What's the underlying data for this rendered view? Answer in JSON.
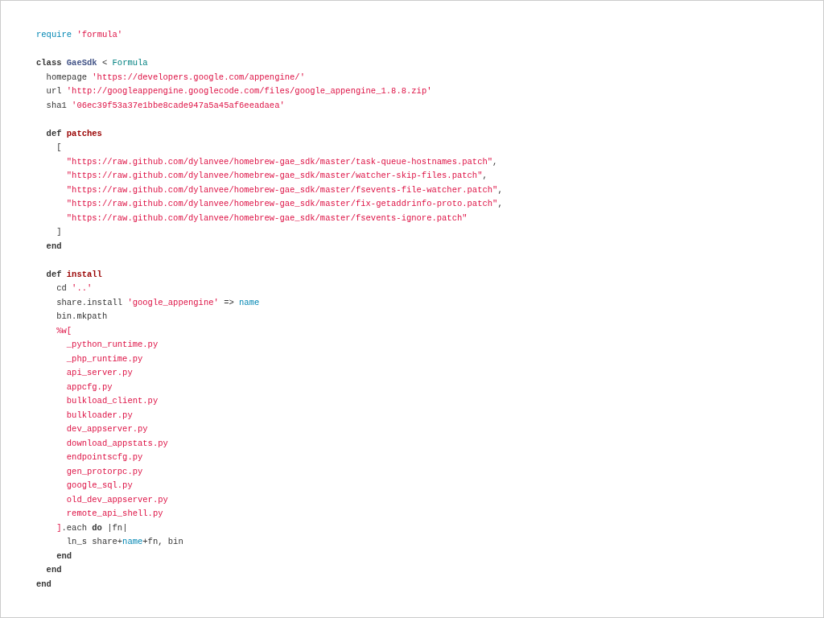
{
  "code": {
    "lines": [
      {
        "kind": "code",
        "tokens": [
          {
            "text": "require ",
            "kind": "builtin"
          },
          {
            "text": "'formula'",
            "kind": "string"
          }
        ]
      },
      {
        "kind": "blank"
      },
      {
        "kind": "code",
        "tokens": [
          {
            "text": "class ",
            "kind": "keyword"
          },
          {
            "text": "GaeSdk",
            "kind": "classname"
          },
          {
            "text": " < ",
            "kind": "plain"
          },
          {
            "text": "Formula",
            "kind": "constant"
          }
        ],
        "children": [
          {
            "kind": "code",
            "tokens": [
              {
                "text": "homepage ",
                "kind": "plain"
              },
              {
                "text": "'https://developers.google.com/appengine/'",
                "kind": "string"
              }
            ]
          },
          {
            "kind": "code",
            "tokens": [
              {
                "text": "url ",
                "kind": "plain"
              },
              {
                "text": "'http://googleappengine.googlecode.com/files/google_appengine_1.8.8.zip'",
                "kind": "string"
              }
            ]
          },
          {
            "kind": "code",
            "tokens": [
              {
                "text": "sha1 ",
                "kind": "plain"
              },
              {
                "text": "'06ec39f53a37e1bbe8cade947a5a45af6eeadaea'",
                "kind": "string"
              }
            ]
          },
          {
            "kind": "blank"
          },
          {
            "kind": "code",
            "tokens": [
              {
                "text": "def ",
                "kind": "keyword"
              },
              {
                "text": "patches",
                "kind": "function"
              }
            ],
            "children": [
              {
                "kind": "code",
                "tokens": [
                  {
                    "text": "[",
                    "kind": "plain"
                  }
                ],
                "children": [
                  {
                    "kind": "code",
                    "tokens": [
                      {
                        "text": "\"https://raw.github.com/dylanvee/homebrew-gae_sdk/master/task-queue-hostnames.patch\"",
                        "kind": "string"
                      },
                      {
                        "text": ",",
                        "kind": "plain"
                      }
                    ]
                  },
                  {
                    "kind": "code",
                    "tokens": [
                      {
                        "text": "\"https://raw.github.com/dylanvee/homebrew-gae_sdk/master/watcher-skip-files.patch\"",
                        "kind": "string"
                      },
                      {
                        "text": ",",
                        "kind": "plain"
                      }
                    ]
                  },
                  {
                    "kind": "code",
                    "tokens": [
                      {
                        "text": "\"https://raw.github.com/dylanvee/homebrew-gae_sdk/master/fsevents-file-watcher.patch\"",
                        "kind": "string"
                      },
                      {
                        "text": ",",
                        "kind": "plain"
                      }
                    ]
                  },
                  {
                    "kind": "code",
                    "tokens": [
                      {
                        "text": "\"https://raw.github.com/dylanvee/homebrew-gae_sdk/master/fix-getaddrinfo-proto.patch\"",
                        "kind": "string"
                      },
                      {
                        "text": ",",
                        "kind": "plain"
                      }
                    ]
                  },
                  {
                    "kind": "code",
                    "tokens": [
                      {
                        "text": "\"https://raw.github.com/dylanvee/homebrew-gae_sdk/master/fsevents-ignore.patch\"",
                        "kind": "string"
                      }
                    ]
                  }
                ]
              },
              {
                "kind": "code",
                "tokens": [
                  {
                    "text": "]",
                    "kind": "plain"
                  }
                ]
              }
            ]
          },
          {
            "kind": "code",
            "tokens": [
              {
                "text": "end",
                "kind": "keyword"
              }
            ]
          },
          {
            "kind": "blank"
          },
          {
            "kind": "code",
            "tokens": [
              {
                "text": "def ",
                "kind": "keyword"
              },
              {
                "text": "install",
                "kind": "function"
              }
            ],
            "children": [
              {
                "kind": "code",
                "tokens": [
                  {
                    "text": "cd ",
                    "kind": "plain"
                  },
                  {
                    "text": "'..'",
                    "kind": "string"
                  }
                ]
              },
              {
                "kind": "code",
                "tokens": [
                  {
                    "text": "share.install ",
                    "kind": "plain"
                  },
                  {
                    "text": "'google_appengine'",
                    "kind": "string"
                  },
                  {
                    "text": " => ",
                    "kind": "plain"
                  },
                  {
                    "text": "name",
                    "kind": "builtin"
                  }
                ]
              },
              {
                "kind": "code",
                "tokens": [
                  {
                    "text": "bin.mkpath",
                    "kind": "plain"
                  }
                ]
              },
              {
                "kind": "code",
                "tokens": [
                  {
                    "text": "%w[",
                    "kind": "string"
                  }
                ],
                "children": [
                  {
                    "kind": "code",
                    "tokens": [
                      {
                        "text": "_python_runtime.py",
                        "kind": "string"
                      }
                    ]
                  },
                  {
                    "kind": "code",
                    "tokens": [
                      {
                        "text": "_php_runtime.py",
                        "kind": "string"
                      }
                    ]
                  },
                  {
                    "kind": "code",
                    "tokens": [
                      {
                        "text": "api_server.py",
                        "kind": "string"
                      }
                    ]
                  },
                  {
                    "kind": "code",
                    "tokens": [
                      {
                        "text": "appcfg.py",
                        "kind": "string"
                      }
                    ]
                  },
                  {
                    "kind": "code",
                    "tokens": [
                      {
                        "text": "bulkload_client.py",
                        "kind": "string"
                      }
                    ]
                  },
                  {
                    "kind": "code",
                    "tokens": [
                      {
                        "text": "bulkloader.py",
                        "kind": "string"
                      }
                    ]
                  },
                  {
                    "kind": "code",
                    "tokens": [
                      {
                        "text": "dev_appserver.py",
                        "kind": "string"
                      }
                    ]
                  },
                  {
                    "kind": "code",
                    "tokens": [
                      {
                        "text": "download_appstats.py",
                        "kind": "string"
                      }
                    ]
                  },
                  {
                    "kind": "code",
                    "tokens": [
                      {
                        "text": "endpointscfg.py",
                        "kind": "string"
                      }
                    ]
                  },
                  {
                    "kind": "code",
                    "tokens": [
                      {
                        "text": "gen_protorpc.py",
                        "kind": "string"
                      }
                    ]
                  },
                  {
                    "kind": "code",
                    "tokens": [
                      {
                        "text": "google_sql.py",
                        "kind": "string"
                      }
                    ]
                  },
                  {
                    "kind": "code",
                    "tokens": [
                      {
                        "text": "old_dev_appserver.py",
                        "kind": "string"
                      }
                    ]
                  },
                  {
                    "kind": "code",
                    "tokens": [
                      {
                        "text": "remote_api_shell.py",
                        "kind": "string"
                      }
                    ]
                  }
                ]
              },
              {
                "kind": "code",
                "tokens": [
                  {
                    "text": "]",
                    "kind": "string"
                  },
                  {
                    "text": ".each ",
                    "kind": "plain"
                  },
                  {
                    "text": "do",
                    "kind": "keyword"
                  },
                  {
                    "text": " |fn|",
                    "kind": "plain"
                  }
                ],
                "children": [
                  {
                    "kind": "code",
                    "tokens": [
                      {
                        "text": "ln_s share+",
                        "kind": "plain"
                      },
                      {
                        "text": "name",
                        "kind": "builtin"
                      },
                      {
                        "text": "+fn, bin",
                        "kind": "plain"
                      }
                    ]
                  }
                ]
              },
              {
                "kind": "code",
                "tokens": [
                  {
                    "text": "end",
                    "kind": "keyword"
                  }
                ]
              }
            ]
          },
          {
            "kind": "code",
            "tokens": [
              {
                "text": "end",
                "kind": "keyword"
              }
            ]
          }
        ]
      },
      {
        "kind": "code",
        "tokens": [
          {
            "text": "end",
            "kind": "keyword"
          }
        ]
      }
    ]
  }
}
